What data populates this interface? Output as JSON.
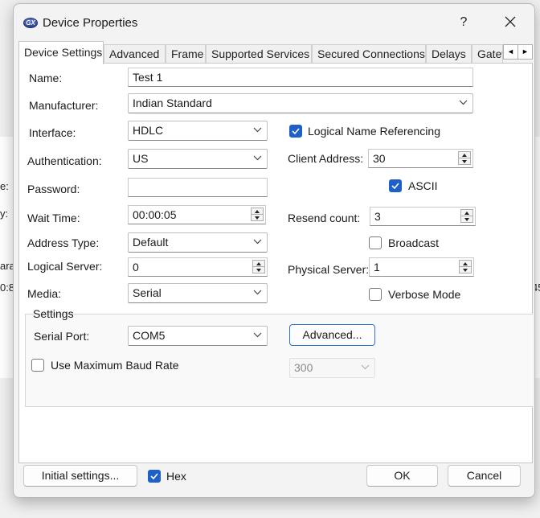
{
  "background": {
    "fragments": [
      "e:",
      "y:",
      "ara",
      "0:8",
      "45"
    ]
  },
  "window": {
    "title": "Device Properties",
    "help_label": "?",
    "logo_text": "GX"
  },
  "tabs": [
    {
      "label": "Device Settings",
      "active": true
    },
    {
      "label": "Advanced"
    },
    {
      "label": "Frame"
    },
    {
      "label": "Supported Services"
    },
    {
      "label": "Secured Connections"
    },
    {
      "label": "Delays"
    },
    {
      "label": "Gatew"
    }
  ],
  "tab_scroll": {
    "left": "◄",
    "right": "►"
  },
  "form": {
    "name": {
      "label": "Name:",
      "value": "Test 1"
    },
    "manufacturer": {
      "label": "Manufacturer:",
      "value": "Indian Standard"
    },
    "interface": {
      "label": "Interface:",
      "value": "HDLC"
    },
    "authentication": {
      "label": "Authentication:",
      "value": "US"
    },
    "password": {
      "label": "Password:",
      "value": ""
    },
    "wait_time": {
      "label": "Wait Time:",
      "value": "00:00:05"
    },
    "address_type": {
      "label": "Address Type:",
      "value": "Default"
    },
    "logical_server": {
      "label": "Logical Server:",
      "value": "0"
    },
    "media": {
      "label": "Media:",
      "value": "Serial"
    },
    "logical_name_referencing": {
      "label": "Logical Name Referencing",
      "checked": true
    },
    "client_address": {
      "label": "Client Address:",
      "value": "30"
    },
    "ascii": {
      "label": "ASCII",
      "checked": true
    },
    "resend_count": {
      "label": "Resend count:",
      "value": "3"
    },
    "broadcast": {
      "label": "Broadcast",
      "checked": false
    },
    "physical_server": {
      "label": "Physical Server:",
      "value": "1"
    },
    "verbose_mode": {
      "label": "Verbose Mode",
      "checked": false
    }
  },
  "settings_group": {
    "title": "Settings",
    "serial_port": {
      "label": "Serial Port:",
      "value": "COM5"
    },
    "advanced_button": "Advanced...",
    "use_max_baud": {
      "label": "Use Maximum Baud Rate",
      "checked": false
    },
    "baud_rate": {
      "value": "300",
      "disabled": true
    }
  },
  "footer": {
    "initial_settings_button": "Initial settings...",
    "hex": {
      "label": "Hex",
      "checked": true
    },
    "ok_button": "OK",
    "cancel_button": "Cancel"
  },
  "colors": {
    "accent": "#1e60c8",
    "dialog_bg": "#f3f3f3",
    "panel_bg": "#ffffff"
  }
}
